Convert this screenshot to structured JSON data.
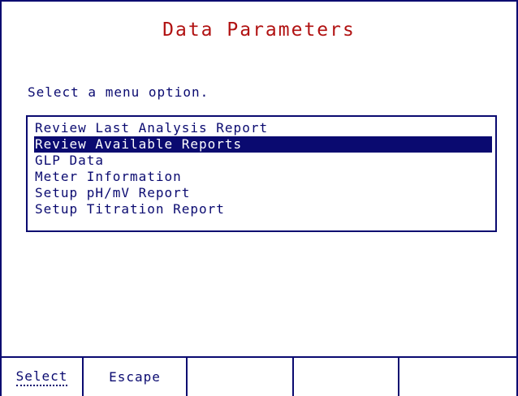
{
  "screen": {
    "title": "Data Parameters",
    "prompt": "Select a menu option."
  },
  "menu": {
    "items": [
      {
        "label": "Review Last Analysis Report",
        "selected": false
      },
      {
        "label": "Review Available Reports",
        "selected": true
      },
      {
        "label": "GLP Data",
        "selected": false
      },
      {
        "label": "Meter Information",
        "selected": false
      },
      {
        "label": "Setup pH/mV Report",
        "selected": false
      },
      {
        "label": "Setup Titration Report",
        "selected": false
      }
    ]
  },
  "softkeys": [
    {
      "label": "Select"
    },
    {
      "label": "Escape"
    },
    {
      "label": ""
    },
    {
      "label": ""
    },
    {
      "label": ""
    }
  ],
  "colors": {
    "title": "#b11212",
    "foreground": "#0a0a70",
    "highlight": "#0a0a70",
    "background": "#ffffff"
  }
}
